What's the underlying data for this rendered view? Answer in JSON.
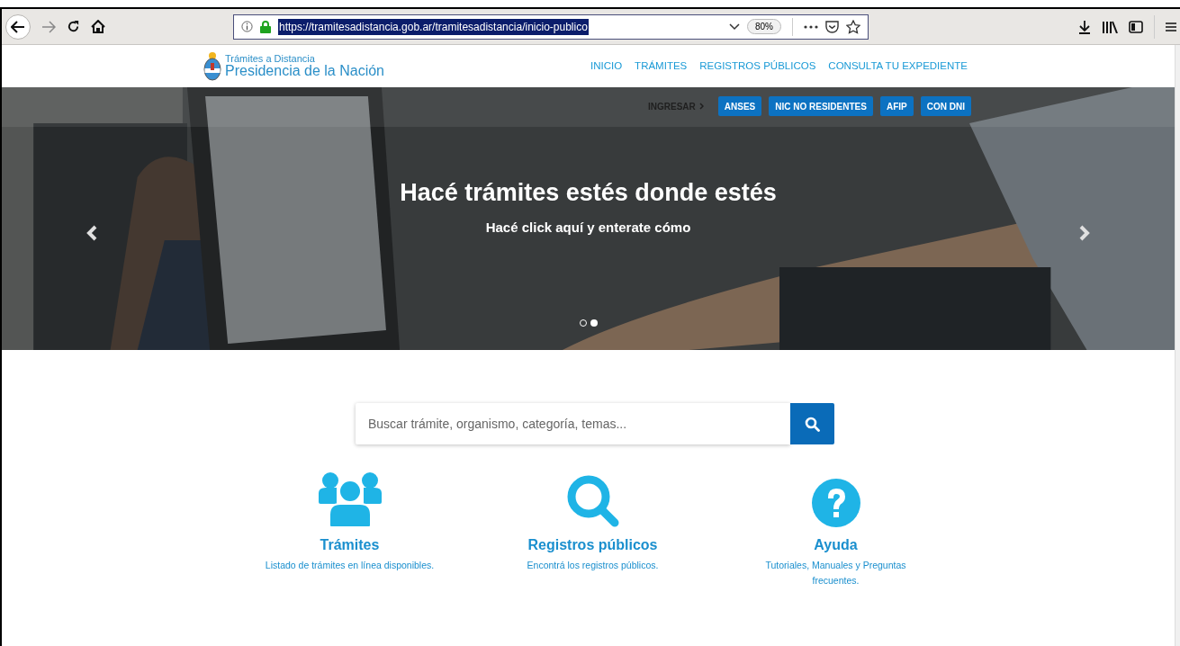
{
  "browser": {
    "url": "https://tramitesadistancia.gob.ar/tramitesadistancia/inicio-publico",
    "zoom": "80%"
  },
  "header": {
    "logo_line1": "Trámites a Distancia",
    "logo_line2": "Presidencia de la Nación",
    "nav": [
      "INICIO",
      "TRÁMITES",
      "REGISTROS PÚBLICOS",
      "CONSULTA TU EXPEDIENTE"
    ]
  },
  "login": {
    "label": "INGRESAR",
    "buttons": [
      "ANSES",
      "NIC NO RESIDENTES",
      "AFIP",
      "CON DNI"
    ]
  },
  "hero": {
    "kind": "picture",
    "title": "Hacé trámites estés donde estés",
    "subtitle": "Hacé click aquí y enterate cómo",
    "dots": [
      {
        "selected": false
      },
      {
        "selected": true
      }
    ]
  },
  "search": {
    "placeholder": "Buscar trámite, organismo, categoría, temas..."
  },
  "features": [
    {
      "kind": "people",
      "title": "Trámites",
      "description": "Listado de trámites en línea disponibles."
    },
    {
      "kind": "search",
      "title": "Registros públicos",
      "description": "Encontrá los registros públicos."
    },
    {
      "kind": "help",
      "title": "Ayuda",
      "description": "Tutoriales, Manuales y Preguntas frecuentes."
    }
  ]
}
